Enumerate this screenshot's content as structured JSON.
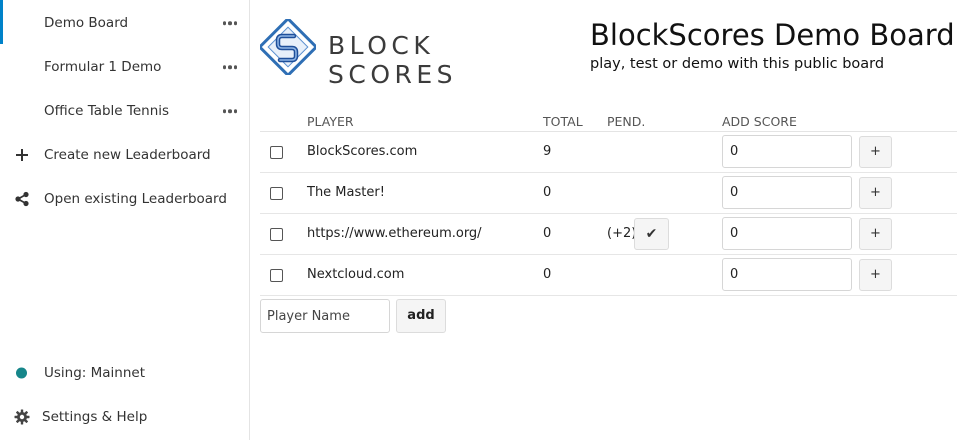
{
  "sidebar": {
    "boards": [
      {
        "label": "Demo Board",
        "active": true
      },
      {
        "label": "Formular 1 Demo",
        "active": false
      },
      {
        "label": "Office Table Tennis",
        "active": false
      }
    ],
    "create_label": "Create new Leaderboard",
    "open_label": "Open existing Leaderboard",
    "network_label": "Using: Mainnet",
    "settings_label": "Settings & Help"
  },
  "brand": {
    "logo_text": "BLOCK SCORES",
    "accent_color": "#2f6fb5",
    "network_color": "#16868a"
  },
  "board": {
    "title": "BlockScores Demo Board",
    "subtitle": "play, test or demo with this public board"
  },
  "table": {
    "headers": {
      "player": "PLAYER",
      "total": "TOTAL",
      "pend": "PEND.",
      "add_score": "ADD SCORE"
    },
    "rows": [
      {
        "player": "BlockScores.com",
        "total": "9",
        "pending": "",
        "score_value": "0"
      },
      {
        "player": "The Master!",
        "total": "0",
        "pending": "",
        "score_value": "0"
      },
      {
        "player": "https://www.ethereum.org/",
        "total": "0",
        "pending": "(+2)",
        "confirm_glyph": "✔",
        "score_value": "0"
      },
      {
        "player": "Nextcloud.com",
        "total": "0",
        "pending": "",
        "score_value": "0"
      }
    ],
    "plus_label": "+"
  },
  "add_player": {
    "placeholder": "Player Name",
    "button_label": "add"
  }
}
